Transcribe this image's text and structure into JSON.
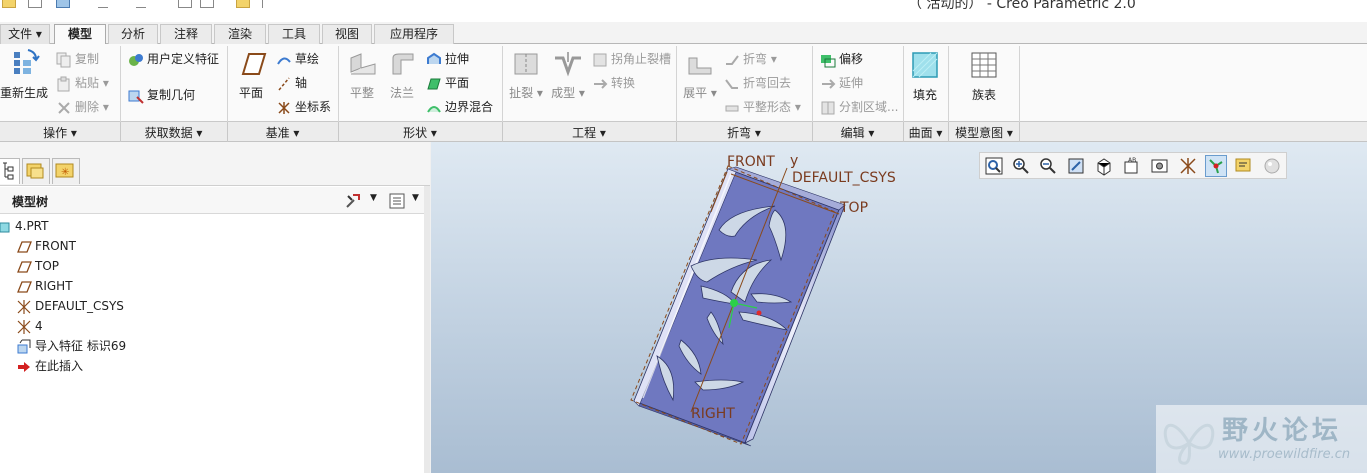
{
  "title": "（ 活动的） - Creo Parametric 2.0",
  "tabs": {
    "file": "文件",
    "items": [
      "模型",
      "分析",
      "注释",
      "渲染",
      "工具",
      "视图",
      "应用程序"
    ],
    "active": "模型"
  },
  "ribbon": {
    "operations": {
      "regenerate": "重新生成",
      "copy": "复制",
      "paste": "粘贴",
      "delete": "删除"
    },
    "get_data": {
      "udf": "用户定义特征",
      "copy_geom": "复制几何"
    },
    "datum": {
      "plane": "平面",
      "sketch": "草绘",
      "axis": "轴",
      "csys": "坐标系"
    },
    "shapes": {
      "flat": "平整",
      "flange": "法兰",
      "extrude": "拉伸",
      "plane": "平面",
      "boundary_blend": "边界混合"
    },
    "engineering": {
      "rip": "扯裂",
      "form": "成型",
      "corner_relief": "拐角止裂槽",
      "convert": "转换"
    },
    "bends": {
      "unbend": "展平",
      "bend": "折弯",
      "bend_back": "折弯回去",
      "flat_state": "平整形态"
    },
    "editing": {
      "offset": "偏移",
      "extend": "延伸",
      "split_area": "分割区域..."
    },
    "surfaces": {
      "fill": "填充"
    },
    "model_intent": {
      "family_table": "族表"
    }
  },
  "groups": [
    "操作",
    "获取数据",
    "基准",
    "形状",
    "工程",
    "折弯",
    "编辑",
    "曲面",
    "模型意图"
  ],
  "model_tree": {
    "title": "模型树",
    "items": [
      {
        "label": "4.PRT",
        "icon": "part-icon"
      },
      {
        "label": "FRONT",
        "icon": "datum-plane-icon"
      },
      {
        "label": "TOP",
        "icon": "datum-plane-icon"
      },
      {
        "label": "RIGHT",
        "icon": "datum-plane-icon"
      },
      {
        "label": "DEFAULT_CSYS",
        "icon": "csys-icon"
      },
      {
        "label": "4",
        "icon": "csys-icon"
      },
      {
        "label": "导入特征 标识69",
        "icon": "import-feature-icon"
      },
      {
        "label": "在此插入",
        "icon": "insert-here-arrow-icon"
      }
    ]
  },
  "viewport": {
    "labels": {
      "front": "FRONT",
      "y": "y",
      "csys": "DEFAULT_CSYS",
      "top": "TOP",
      "right": "RIGHT"
    }
  },
  "watermark": {
    "title": "野火论坛",
    "url": "www.proewildfire.cn"
  },
  "colors": {
    "viewport_top": "#dfe9f2",
    "viewport_bottom": "#a9bdd2",
    "part_fill": "#6f78c0",
    "datum_label": "#7a3b1f",
    "active_tab_text": "#000000"
  }
}
